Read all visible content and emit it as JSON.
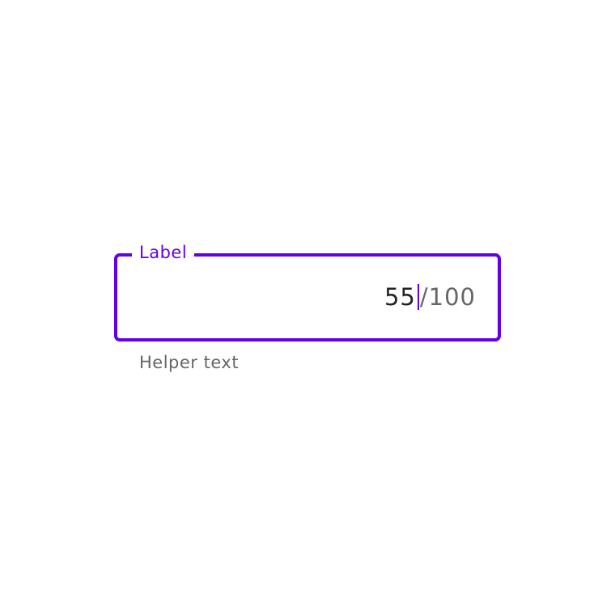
{
  "field": {
    "label": "Label",
    "value": "55",
    "suffix": "/100",
    "helper_text": "Helper text",
    "state": "focused"
  },
  "colors": {
    "accent": "#6200ee",
    "text": "#222222",
    "secondary_text": "#666666",
    "background": "#ffffff"
  }
}
